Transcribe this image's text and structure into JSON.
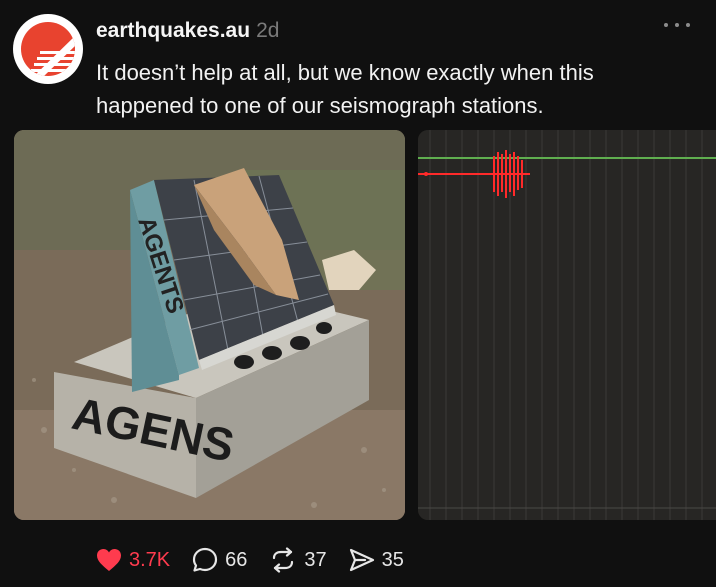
{
  "post": {
    "username": "earthquakes.au",
    "time": "2d",
    "caption": "It doesn’t help at all, but we know exactly when this happened to one of our seismograph stations.",
    "avatar_icon": "earthquakes-au-logo",
    "more_icon": "more-horizontal-icon"
  },
  "media": {
    "photo_graffiti_top": "AGENTS",
    "photo_graffiti_side": "AGENS"
  },
  "actions": {
    "likes": "3.7K",
    "comments": "66",
    "reposts": "37",
    "shares": "35",
    "like_icon": "heart-icon",
    "comment_icon": "comment-icon",
    "repost_icon": "repost-icon",
    "share_icon": "send-icon"
  },
  "colors": {
    "background": "#101010",
    "like": "#ff3b4e",
    "brand": "#e8432f"
  }
}
